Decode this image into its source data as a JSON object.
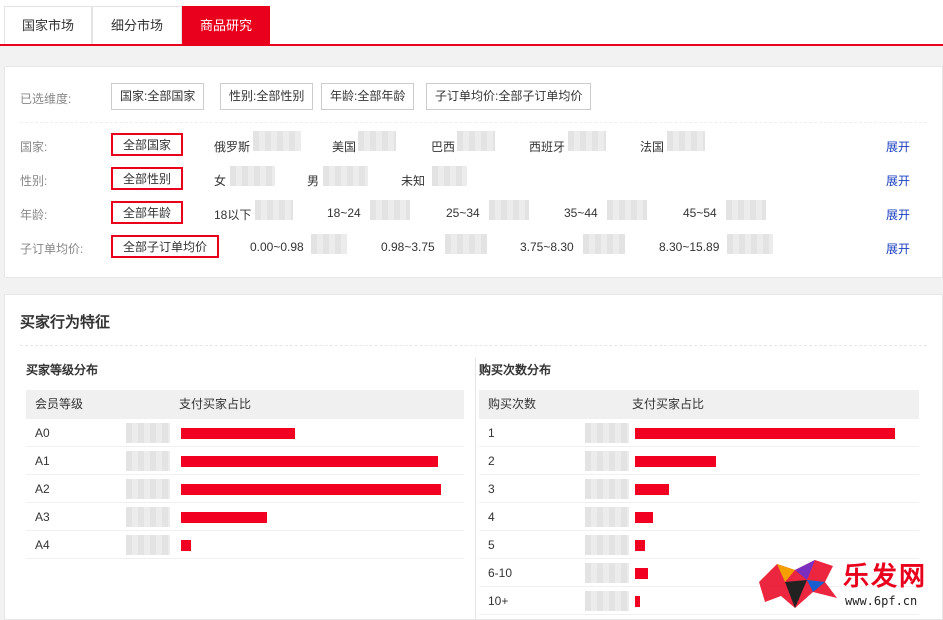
{
  "tabs": [
    {
      "label": "国家市场",
      "active": false
    },
    {
      "label": "细分市场",
      "active": false
    },
    {
      "label": "商品研究",
      "active": true
    }
  ],
  "filters": {
    "selected_label": "已选维度:",
    "selected_chips": [
      "国家:全部国家",
      "性别:全部性别",
      "年龄:全部年龄",
      "子订单均价:全部子订单均价"
    ],
    "expand_label": "展开",
    "rows": [
      {
        "label": "国家:",
        "all": "全部国家",
        "options": [
          "俄罗斯",
          "美国",
          "巴西",
          "西班牙",
          "法国"
        ]
      },
      {
        "label": "性别:",
        "all": "全部性别",
        "options": [
          "女",
          "男",
          "未知"
        ]
      },
      {
        "label": "年龄:",
        "all": "全部年龄",
        "options": [
          "18以下",
          "18~24",
          "25~34",
          "35~44",
          "45~54"
        ]
      },
      {
        "label": "子订单均价:",
        "all": "全部子订单均价",
        "options": [
          "0.00~0.98",
          "0.98~3.75",
          "3.75~8.30",
          "8.30~15.89"
        ]
      }
    ]
  },
  "section": {
    "title": "买家行为特征",
    "level_dist": {
      "title": "买家等级分布",
      "col1": "会员等级",
      "col2": "支付买家占比",
      "rows": [
        {
          "label": "A0",
          "share": 0.44
        },
        {
          "label": "A1",
          "share": 0.99
        },
        {
          "label": "A2",
          "share": 1.0
        },
        {
          "label": "A3",
          "share": 0.33
        },
        {
          "label": "A4",
          "share": 0.04
        }
      ]
    },
    "purchase_dist": {
      "title": "购买次数分布",
      "col1": "购买次数",
      "col2": "支付买家占比",
      "rows": [
        {
          "label": "1",
          "share": 1.0
        },
        {
          "label": "2",
          "share": 0.31
        },
        {
          "label": "3",
          "share": 0.13
        },
        {
          "label": "4",
          "share": 0.07
        },
        {
          "label": "5",
          "share": 0.04
        },
        {
          "label": "6-10",
          "share": 0.05
        },
        {
          "label": "10+",
          "share": 0.02
        }
      ]
    }
  },
  "watermark": {
    "text": "乐发网",
    "url": "www.6pf.cn"
  },
  "colors": {
    "accent": "#e8001c",
    "bar": "#f10022",
    "link": "#1a3fbf"
  }
}
